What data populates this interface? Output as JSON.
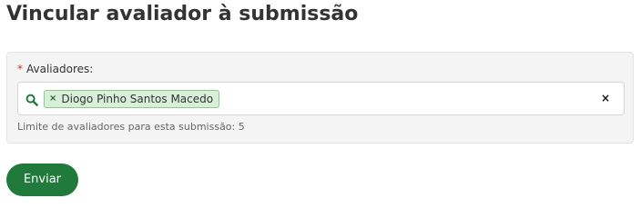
{
  "page": {
    "title": "Vincular avaliador à submissão"
  },
  "form": {
    "required_marker": "*",
    "field_label": "Avaliadores:",
    "search_icon": "search-icon",
    "selected_items": [
      {
        "remove_symbol": "×",
        "label": "Diogo Pinho Santos Macedo"
      }
    ],
    "clear_symbol": "×",
    "help_text": "Limite de avaliadores para esta submissão: 5"
  },
  "actions": {
    "submit_label": "Enviar"
  },
  "colors": {
    "accent": "#1f7a3c",
    "chip_background": "#d8f0d8",
    "chip_border": "#8fc88f",
    "required": "#c0392b",
    "panel_background": "#f4f4f4"
  }
}
